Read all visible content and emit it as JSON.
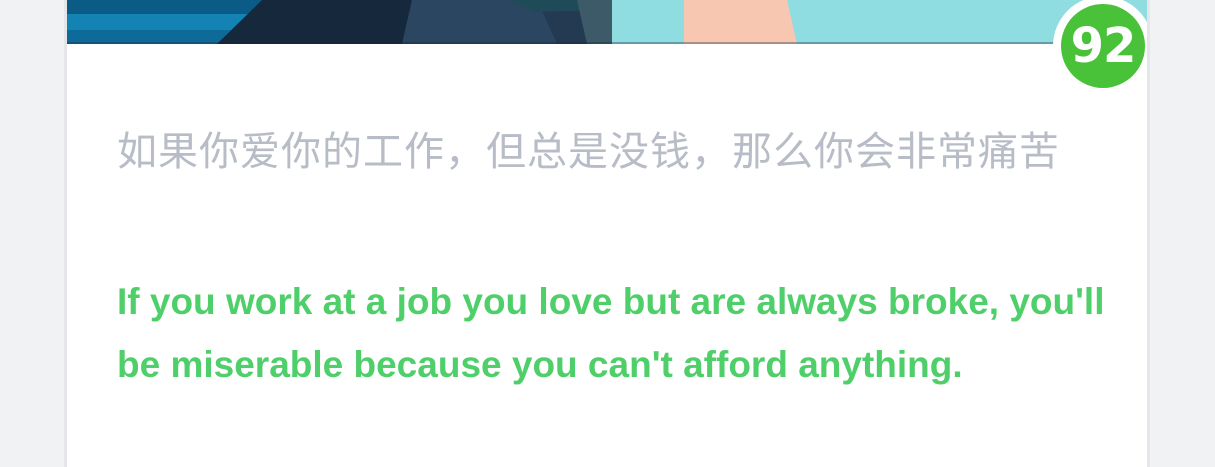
{
  "score": {
    "value": "92",
    "color": "#49c23a"
  },
  "sentence": {
    "chinese": "如果你爱你的工作，但总是没钱，那么你会非常痛苦",
    "english": "If you work at a job you love but are always broke, you'll be miserable because you can't afford anything."
  },
  "colors": {
    "chinese_text": "#b7bcc6",
    "english_text": "#4fcf6a",
    "background": "#f1f2f4"
  }
}
